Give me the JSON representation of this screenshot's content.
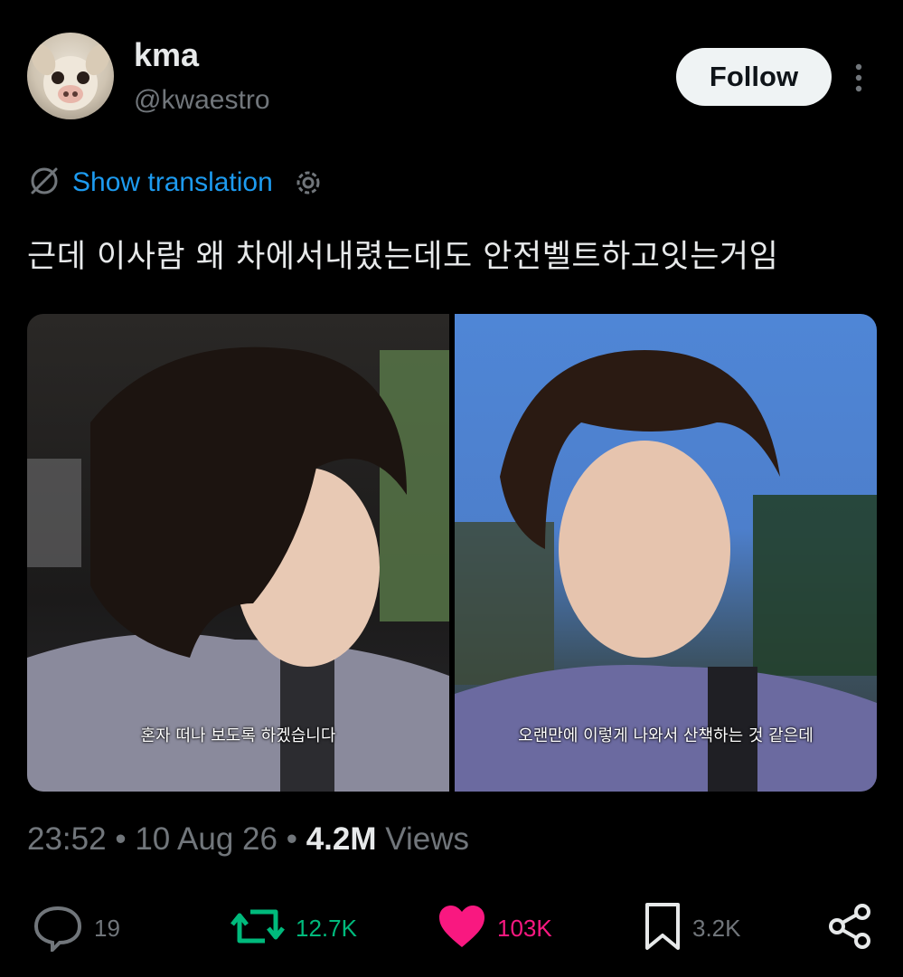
{
  "author": {
    "name": "kma",
    "handle": "@kwaestro"
  },
  "follow_label": "Follow",
  "translation_label": "Show translation",
  "tweet_text": "근데 이사람 왜 차에서내렸는데도 안전벨트하고잇는거임",
  "media": {
    "left_caption": "혼자 떠나 보도록 하겠습니다",
    "right_caption": "오랜만에 이렇게 나와서 산책하는 것 같은데"
  },
  "meta": {
    "time": "23:52",
    "date": "10 Aug 26",
    "views_count": "4.2M",
    "views_label": "Views",
    "separator": "•"
  },
  "actions": {
    "replies": "19",
    "reposts": "12.7K",
    "likes": "103K",
    "bookmarks": "3.2K"
  },
  "colors": {
    "background": "#000000",
    "link": "#1d9bf0",
    "repost": "#00ba7c",
    "like": "#f91880",
    "muted": "#71767b"
  },
  "icons": [
    "translate-off-icon",
    "gear-icon",
    "more-vertical-icon",
    "reply-icon",
    "repost-icon",
    "like-icon",
    "bookmark-icon",
    "share-icon"
  ]
}
